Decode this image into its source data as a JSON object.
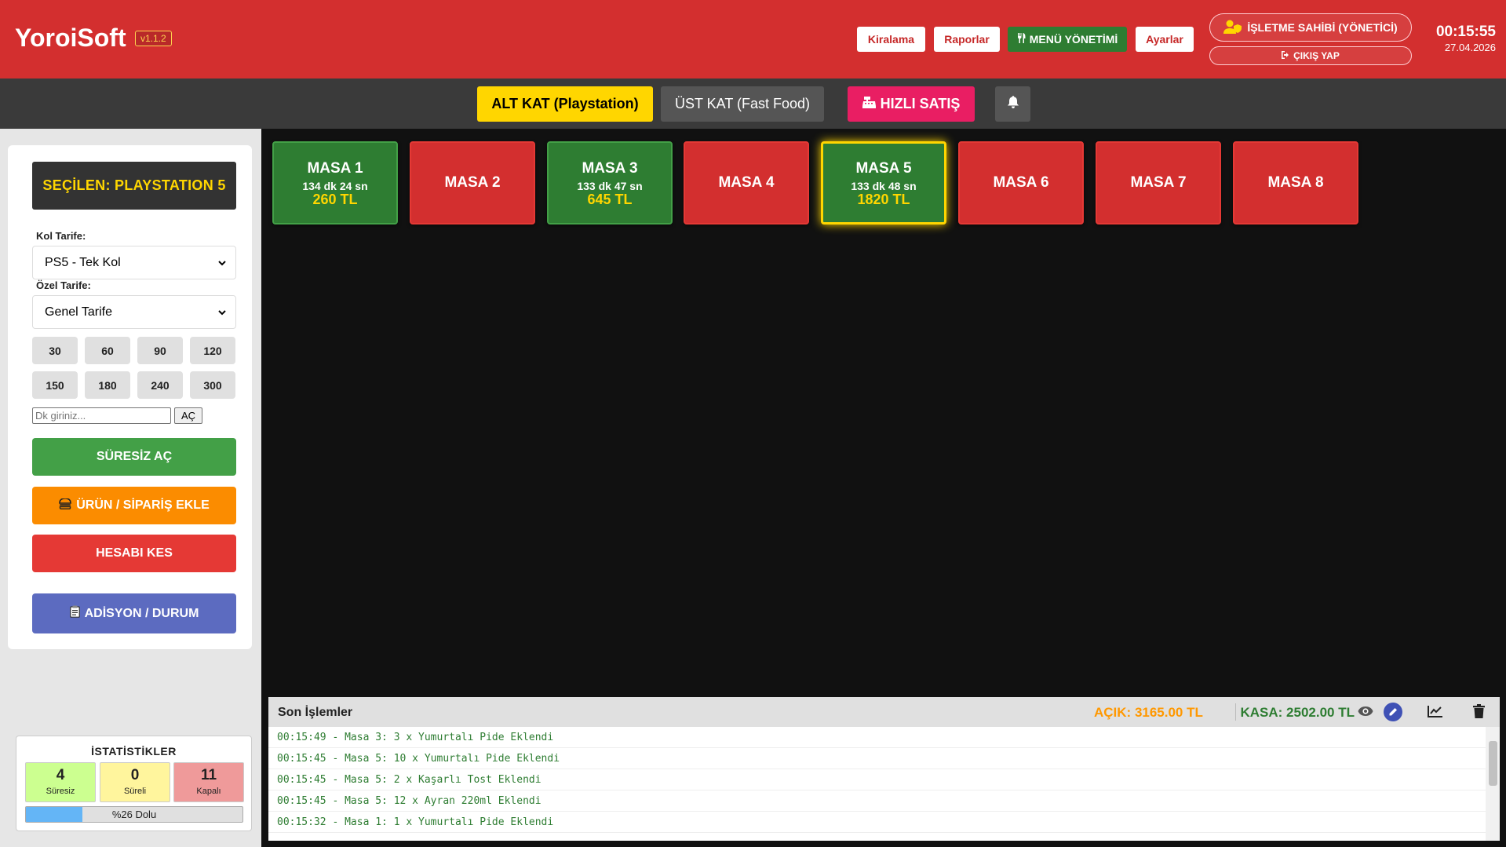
{
  "app": {
    "name": "YoroiSoft",
    "version": "v1.1.2"
  },
  "header": {
    "buttons": [
      "Kiralama",
      "Raporlar",
      "MENÜ YÖNETİMİ",
      "Ayarlar"
    ],
    "owner_label": "İŞLETME SAHİBİ (YÖNETİCİ)",
    "logout_label": "ÇIKIŞ YAP",
    "time": "00:15:55",
    "date": "27.04.2026"
  },
  "floors": {
    "tabs": [
      "ALT KAT (Playstation)",
      "ÜST KAT (Fast Food)"
    ],
    "active_index": 0,
    "quick_sale": "HIZLI SATIŞ"
  },
  "panel": {
    "selected": "SEÇİLEN: PLAYSTATION 5",
    "kol_label": "Kol Tarife:",
    "kol_value": "PS5 - Tek Kol",
    "ozel_label": "Özel Tarife:",
    "ozel_value": "Genel Tarife",
    "durations": [
      "30",
      "60",
      "90",
      "120",
      "150",
      "180",
      "240",
      "300"
    ],
    "minutes_placeholder": "Dk giriniz...",
    "open_button": "AÇ",
    "btn_unlimited": "SÜRESİZ AÇ",
    "btn_add_order": "ÜRÜN / SİPARİŞ EKLE",
    "btn_checkout": "HESABI KES",
    "btn_bill": "ADİSYON / DURUM"
  },
  "stats": {
    "title": "İSTATİSTİKLER",
    "items": [
      {
        "value": "4",
        "label": "Süresiz",
        "color": "#ccff90"
      },
      {
        "value": "0",
        "label": "Süreli",
        "color": "#fff59d"
      },
      {
        "value": "11",
        "label": "Kapalı",
        "color": "#ef9a9a"
      }
    ],
    "fill_percent": 26,
    "fill_text": "%26 Dolu"
  },
  "tables": [
    {
      "name": "MASA 1",
      "time": "134 dk 24 sn",
      "amount": "260 TL",
      "status": "active"
    },
    {
      "name": "MASA 2",
      "status": "closed"
    },
    {
      "name": "MASA 3",
      "time": "133 dk 47 sn",
      "amount": "645 TL",
      "status": "active"
    },
    {
      "name": "MASA 4",
      "status": "closed"
    },
    {
      "name": "MASA 5",
      "time": "133 dk 48 sn",
      "amount": "1820 TL",
      "status": "active",
      "selected": true
    },
    {
      "name": "MASA 6",
      "status": "closed"
    },
    {
      "name": "MASA 7",
      "status": "closed"
    },
    {
      "name": "MASA 8",
      "status": "closed"
    }
  ],
  "log": {
    "title": "Son İşlemler",
    "acik": "AÇIK: 3165.00 TL",
    "kasa": "KASA: 2502.00 TL",
    "lines": [
      "00:15:49 - Masa 3: 3 x Yumurtalı Pide Eklendi",
      "00:15:45 - Masa 5: 10 x Yumurtalı Pide Eklendi",
      "00:15:45 - Masa 5: 2 x Kaşarlı Tost Eklendi",
      "00:15:45 - Masa 5: 12 x Ayran 220ml Eklendi",
      "00:15:32 - Masa 1: 1 x Yumurtalı Pide Eklendi"
    ]
  },
  "colors": {
    "header_bg": "#d32f2f",
    "active_tab": "#ffd600",
    "quick_sale": "#e91e63",
    "table_active": "#2e7d32",
    "table_closed": "#d32f2f",
    "btn_unlimited": "#43a047",
    "btn_add_order": "#fb8c00",
    "btn_checkout": "#e53935",
    "btn_bill": "#5c6bc0"
  },
  "icons": [
    "utensils-icon",
    "user-shield-icon",
    "sign-out-icon",
    "cash-register-icon",
    "bell-icon",
    "burger-icon",
    "clipboard-icon",
    "eye-icon",
    "edit-icon",
    "chart-line-icon",
    "trash-icon"
  ]
}
